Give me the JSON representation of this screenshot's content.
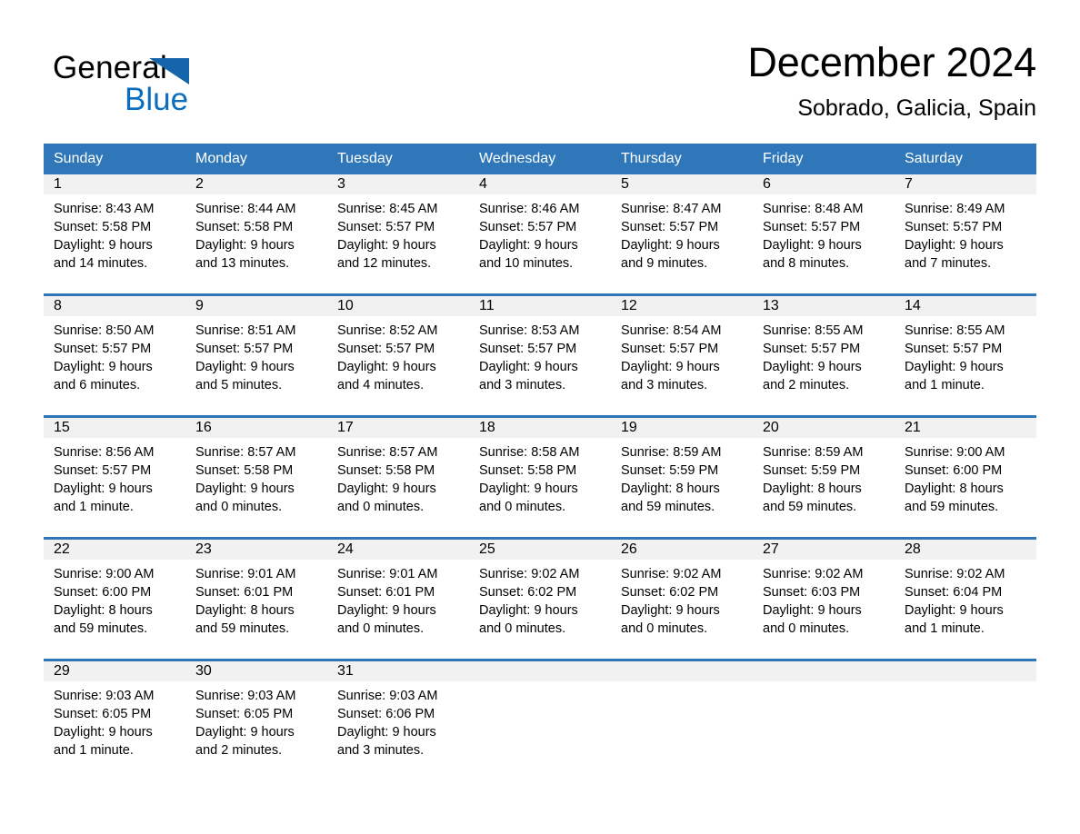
{
  "brand": {
    "name_part1": "General",
    "name_part2": "Blue",
    "logo_icon": "triangle-flag-icon",
    "accent_color": "#2f77b8",
    "blue_text_color": "#0b6dbf"
  },
  "header": {
    "month_title": "December 2024",
    "location": "Sobrado, Galicia, Spain"
  },
  "calendar": {
    "weekday_headers": [
      "Sunday",
      "Monday",
      "Tuesday",
      "Wednesday",
      "Thursday",
      "Friday",
      "Saturday"
    ],
    "header_bg": "#2f77b8",
    "daynum_bg": "#f1f1f1",
    "weeks": [
      [
        {
          "day": "1",
          "sunrise": "Sunrise: 8:43 AM",
          "sunset": "Sunset: 5:58 PM",
          "daylight_line1": "Daylight: 9 hours",
          "daylight_line2": "and 14 minutes."
        },
        {
          "day": "2",
          "sunrise": "Sunrise: 8:44 AM",
          "sunset": "Sunset: 5:58 PM",
          "daylight_line1": "Daylight: 9 hours",
          "daylight_line2": "and 13 minutes."
        },
        {
          "day": "3",
          "sunrise": "Sunrise: 8:45 AM",
          "sunset": "Sunset: 5:57 PM",
          "daylight_line1": "Daylight: 9 hours",
          "daylight_line2": "and 12 minutes."
        },
        {
          "day": "4",
          "sunrise": "Sunrise: 8:46 AM",
          "sunset": "Sunset: 5:57 PM",
          "daylight_line1": "Daylight: 9 hours",
          "daylight_line2": "and 10 minutes."
        },
        {
          "day": "5",
          "sunrise": "Sunrise: 8:47 AM",
          "sunset": "Sunset: 5:57 PM",
          "daylight_line1": "Daylight: 9 hours",
          "daylight_line2": "and 9 minutes."
        },
        {
          "day": "6",
          "sunrise": "Sunrise: 8:48 AM",
          "sunset": "Sunset: 5:57 PM",
          "daylight_line1": "Daylight: 9 hours",
          "daylight_line2": "and 8 minutes."
        },
        {
          "day": "7",
          "sunrise": "Sunrise: 8:49 AM",
          "sunset": "Sunset: 5:57 PM",
          "daylight_line1": "Daylight: 9 hours",
          "daylight_line2": "and 7 minutes."
        }
      ],
      [
        {
          "day": "8",
          "sunrise": "Sunrise: 8:50 AM",
          "sunset": "Sunset: 5:57 PM",
          "daylight_line1": "Daylight: 9 hours",
          "daylight_line2": "and 6 minutes."
        },
        {
          "day": "9",
          "sunrise": "Sunrise: 8:51 AM",
          "sunset": "Sunset: 5:57 PM",
          "daylight_line1": "Daylight: 9 hours",
          "daylight_line2": "and 5 minutes."
        },
        {
          "day": "10",
          "sunrise": "Sunrise: 8:52 AM",
          "sunset": "Sunset: 5:57 PM",
          "daylight_line1": "Daylight: 9 hours",
          "daylight_line2": "and 4 minutes."
        },
        {
          "day": "11",
          "sunrise": "Sunrise: 8:53 AM",
          "sunset": "Sunset: 5:57 PM",
          "daylight_line1": "Daylight: 9 hours",
          "daylight_line2": "and 3 minutes."
        },
        {
          "day": "12",
          "sunrise": "Sunrise: 8:54 AM",
          "sunset": "Sunset: 5:57 PM",
          "daylight_line1": "Daylight: 9 hours",
          "daylight_line2": "and 3 minutes."
        },
        {
          "day": "13",
          "sunrise": "Sunrise: 8:55 AM",
          "sunset": "Sunset: 5:57 PM",
          "daylight_line1": "Daylight: 9 hours",
          "daylight_line2": "and 2 minutes."
        },
        {
          "day": "14",
          "sunrise": "Sunrise: 8:55 AM",
          "sunset": "Sunset: 5:57 PM",
          "daylight_line1": "Daylight: 9 hours",
          "daylight_line2": "and 1 minute."
        }
      ],
      [
        {
          "day": "15",
          "sunrise": "Sunrise: 8:56 AM",
          "sunset": "Sunset: 5:57 PM",
          "daylight_line1": "Daylight: 9 hours",
          "daylight_line2": "and 1 minute."
        },
        {
          "day": "16",
          "sunrise": "Sunrise: 8:57 AM",
          "sunset": "Sunset: 5:58 PM",
          "daylight_line1": "Daylight: 9 hours",
          "daylight_line2": "and 0 minutes."
        },
        {
          "day": "17",
          "sunrise": "Sunrise: 8:57 AM",
          "sunset": "Sunset: 5:58 PM",
          "daylight_line1": "Daylight: 9 hours",
          "daylight_line2": "and 0 minutes."
        },
        {
          "day": "18",
          "sunrise": "Sunrise: 8:58 AM",
          "sunset": "Sunset: 5:58 PM",
          "daylight_line1": "Daylight: 9 hours",
          "daylight_line2": "and 0 minutes."
        },
        {
          "day": "19",
          "sunrise": "Sunrise: 8:59 AM",
          "sunset": "Sunset: 5:59 PM",
          "daylight_line1": "Daylight: 8 hours",
          "daylight_line2": "and 59 minutes."
        },
        {
          "day": "20",
          "sunrise": "Sunrise: 8:59 AM",
          "sunset": "Sunset: 5:59 PM",
          "daylight_line1": "Daylight: 8 hours",
          "daylight_line2": "and 59 minutes."
        },
        {
          "day": "21",
          "sunrise": "Sunrise: 9:00 AM",
          "sunset": "Sunset: 6:00 PM",
          "daylight_line1": "Daylight: 8 hours",
          "daylight_line2": "and 59 minutes."
        }
      ],
      [
        {
          "day": "22",
          "sunrise": "Sunrise: 9:00 AM",
          "sunset": "Sunset: 6:00 PM",
          "daylight_line1": "Daylight: 8 hours",
          "daylight_line2": "and 59 minutes."
        },
        {
          "day": "23",
          "sunrise": "Sunrise: 9:01 AM",
          "sunset": "Sunset: 6:01 PM",
          "daylight_line1": "Daylight: 8 hours",
          "daylight_line2": "and 59 minutes."
        },
        {
          "day": "24",
          "sunrise": "Sunrise: 9:01 AM",
          "sunset": "Sunset: 6:01 PM",
          "daylight_line1": "Daylight: 9 hours",
          "daylight_line2": "and 0 minutes."
        },
        {
          "day": "25",
          "sunrise": "Sunrise: 9:02 AM",
          "sunset": "Sunset: 6:02 PM",
          "daylight_line1": "Daylight: 9 hours",
          "daylight_line2": "and 0 minutes."
        },
        {
          "day": "26",
          "sunrise": "Sunrise: 9:02 AM",
          "sunset": "Sunset: 6:02 PM",
          "daylight_line1": "Daylight: 9 hours",
          "daylight_line2": "and 0 minutes."
        },
        {
          "day": "27",
          "sunrise": "Sunrise: 9:02 AM",
          "sunset": "Sunset: 6:03 PM",
          "daylight_line1": "Daylight: 9 hours",
          "daylight_line2": "and 0 minutes."
        },
        {
          "day": "28",
          "sunrise": "Sunrise: 9:02 AM",
          "sunset": "Sunset: 6:04 PM",
          "daylight_line1": "Daylight: 9 hours",
          "daylight_line2": "and 1 minute."
        }
      ],
      [
        {
          "day": "29",
          "sunrise": "Sunrise: 9:03 AM",
          "sunset": "Sunset: 6:05 PM",
          "daylight_line1": "Daylight: 9 hours",
          "daylight_line2": "and 1 minute."
        },
        {
          "day": "30",
          "sunrise": "Sunrise: 9:03 AM",
          "sunset": "Sunset: 6:05 PM",
          "daylight_line1": "Daylight: 9 hours",
          "daylight_line2": "and 2 minutes."
        },
        {
          "day": "31",
          "sunrise": "Sunrise: 9:03 AM",
          "sunset": "Sunset: 6:06 PM",
          "daylight_line1": "Daylight: 9 hours",
          "daylight_line2": "and 3 minutes."
        },
        {
          "day": "",
          "sunrise": "",
          "sunset": "",
          "daylight_line1": "",
          "daylight_line2": ""
        },
        {
          "day": "",
          "sunrise": "",
          "sunset": "",
          "daylight_line1": "",
          "daylight_line2": ""
        },
        {
          "day": "",
          "sunrise": "",
          "sunset": "",
          "daylight_line1": "",
          "daylight_line2": ""
        },
        {
          "day": "",
          "sunrise": "",
          "sunset": "",
          "daylight_line1": "",
          "daylight_line2": ""
        }
      ]
    ]
  }
}
